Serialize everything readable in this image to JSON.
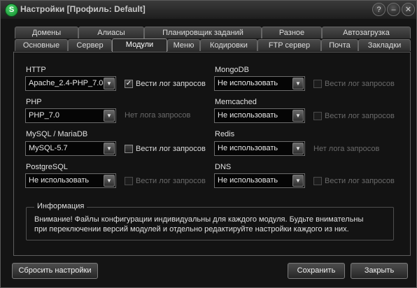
{
  "window": {
    "title": "Настройки [Профиль: Default]",
    "icon_letter": "S"
  },
  "title_buttons": {
    "help": "?",
    "minimize": "–",
    "close": "✕"
  },
  "tabs_row1": [
    "Домены",
    "Алиасы",
    "Планировщик заданий",
    "Разное",
    "Автозагрузка"
  ],
  "tabs_row2": [
    "Основные",
    "Сервер",
    "Модули",
    "Меню",
    "Кодировки",
    "FTP сервер",
    "Почта",
    "Закладки"
  ],
  "active_tab": "Модули",
  "modules": {
    "http": {
      "label": "HTTP",
      "value": "Apache_2.4-PHP_7.0-",
      "log": {
        "label": "Вести лог запросов",
        "checked": true,
        "enabled": true
      }
    },
    "php": {
      "label": "PHP",
      "value": "PHP_7.0",
      "note": "Нет лога запросов"
    },
    "mysql": {
      "label": "MySQL / MariaDB",
      "value": "MySQL-5.7",
      "log": {
        "label": "Вести лог запросов",
        "checked": false,
        "enabled": true
      }
    },
    "postgres": {
      "label": "PostgreSQL",
      "value": "Не использовать",
      "log": {
        "label": "Вести лог запросов",
        "checked": false,
        "enabled": false
      }
    },
    "mongodb": {
      "label": "MongoDB",
      "value": "Не использовать",
      "log": {
        "label": "Вести лог запросов",
        "checked": false,
        "enabled": false
      }
    },
    "memcached": {
      "label": "Memcached",
      "value": "Не использовать",
      "log": {
        "label": "Вести лог запросов",
        "checked": false,
        "enabled": false
      }
    },
    "redis": {
      "label": "Redis",
      "value": "Не использовать",
      "note": "Нет лога запросов"
    },
    "dns": {
      "label": "DNS",
      "value": "Не использовать",
      "log": {
        "label": "Вести лог запросов",
        "checked": false,
        "enabled": false
      }
    }
  },
  "info": {
    "title": "Информация",
    "line1": "Внимание! Файлы конфигурации индивидуальны для каждого модуля. Будьте внимательны",
    "line2": "при переключении версий модулей и отдельно редактируйте настройки каждого из них."
  },
  "buttons": {
    "reset": "Сбросить настройки",
    "save": "Сохранить",
    "close": "Закрыть"
  },
  "icons": {
    "dropdown": "chevron-down-icon",
    "check": "checkmark-icon"
  },
  "colors": {
    "app_icon": "#2db84c",
    "panel_bg": "#131313",
    "disabled_text": "#6a6a6a"
  }
}
